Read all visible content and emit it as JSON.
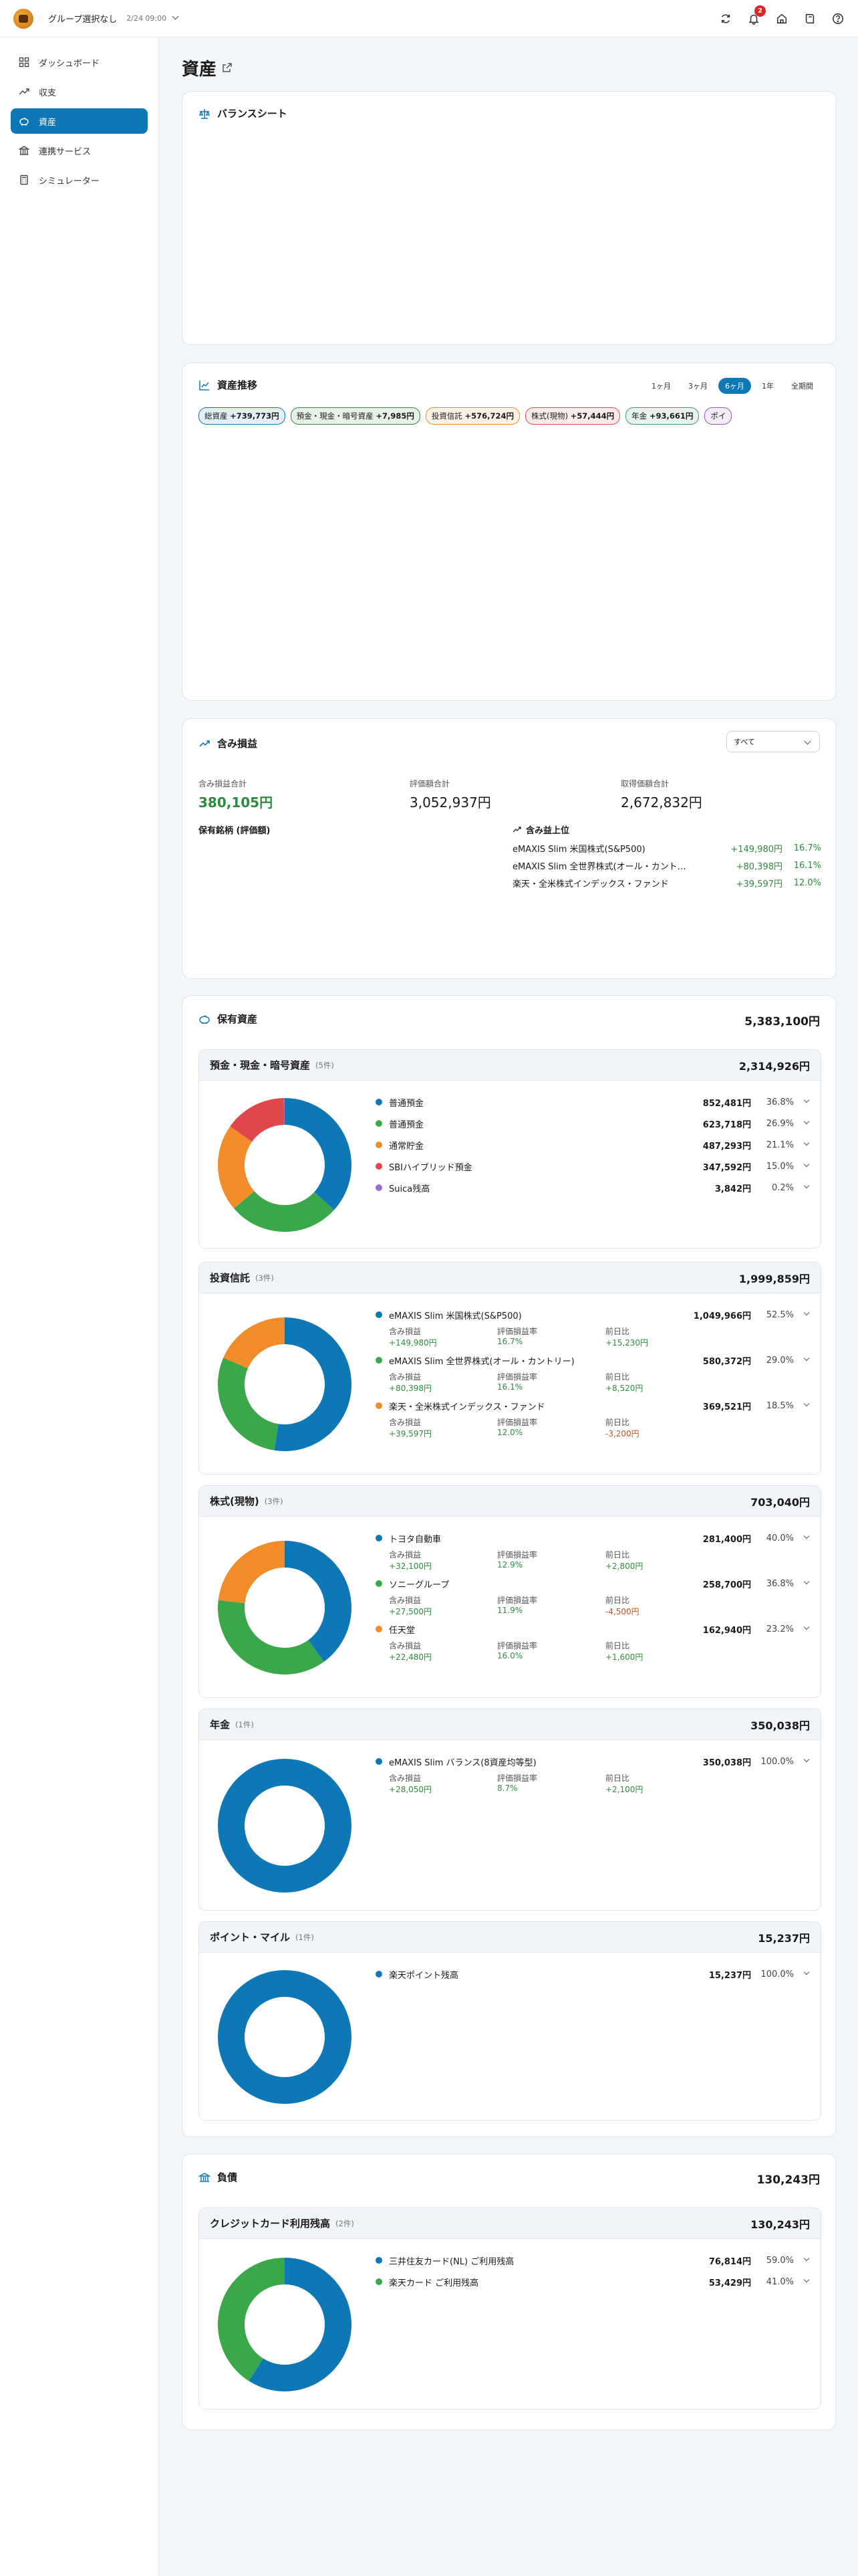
{
  "header": {
    "group": "グループ選択なし",
    "date": "2/24 09:00",
    "notif_count": "2"
  },
  "nav": [
    "ダッシュボード",
    "収支",
    "資産",
    "連携サービス",
    "シミュレーター"
  ],
  "page_title": "資産",
  "balance": {
    "title": "バランスシート"
  },
  "trend": {
    "title": "資産推移",
    "ranges": [
      "1ヶ月",
      "3ヶ月",
      "6ヶ月",
      "1年",
      "全期間"
    ],
    "chips": [
      {
        "label": "総資産",
        "value": "+739,773円",
        "color": "#0e78b7"
      },
      {
        "label": "預金・現金・暗号資産",
        "value": "+7,985円",
        "color": "#2e8b3e"
      },
      {
        "label": "投資信託",
        "value": "+576,724円",
        "color": "#f28c28"
      },
      {
        "label": "株式(現物)",
        "value": "+57,444円",
        "color": "#e05252"
      },
      {
        "label": "年金",
        "value": "+93,661円",
        "color": "#3aa06a"
      },
      {
        "label": "ポイ",
        "value": "",
        "color": "#9b59b6"
      }
    ]
  },
  "unrealized": {
    "title": "含み損益",
    "filter": "すべて",
    "stats": [
      {
        "label": "含み損益合計",
        "value": "380,105円"
      },
      {
        "label": "評価額合計",
        "value": "3,052,937円"
      },
      {
        "label": "取得価額合計",
        "value": "2,672,832円"
      }
    ],
    "by_holding": "保有銘柄 (評価額)",
    "top_title": "含み益上位",
    "top": [
      {
        "name": "eMAXIS Slim 米国株式(S&P500)",
        "amount": "+149,980円",
        "pct": "16.7%"
      },
      {
        "name": "eMAXIS Slim 全世界株式(オール・カント…",
        "amount": "+80,398円",
        "pct": "16.1%"
      },
      {
        "name": "楽天・全米株式インデックス・ファンド",
        "amount": "+39,597円",
        "pct": "12.0%"
      }
    ]
  },
  "labels": {
    "gain": "含み損益",
    "rate": "評価損益率",
    "day": "前日比"
  },
  "holdings": {
    "title": "保有資産",
    "total": "5,383,100円",
    "groups": [
      {
        "name": "預金・現金・暗号資産",
        "count": "(5件)",
        "amount": "2,314,926円",
        "items": [
          {
            "name": "普通預金",
            "amount": "852,481円",
            "pct": "36.8%",
            "share": 36.8,
            "color": "#0e78b7"
          },
          {
            "name": "普通預金",
            "amount": "623,718円",
            "pct": "26.9%",
            "share": 26.9,
            "color": "#3aa84a"
          },
          {
            "name": "通常貯金",
            "amount": "487,293円",
            "pct": "21.1%",
            "share": 21.1,
            "color": "#f28c28"
          },
          {
            "name": "SBIハイブリッド預金",
            "amount": "347,592円",
            "pct": "15.0%",
            "share": 15.0,
            "color": "#e0474c"
          },
          {
            "name": "Suica残高",
            "amount": "3,842円",
            "pct": "0.2%",
            "share": 0.2,
            "color": "#9b6bd0"
          }
        ]
      },
      {
        "name": "投資信託",
        "count": "(3件)",
        "amount": "1,999,859円",
        "items": [
          {
            "name": "eMAXIS Slim 米国株式(S&P500)",
            "amount": "1,049,966円",
            "pct": "52.5%",
            "share": 52.5,
            "color": "#0e78b7",
            "gain": "+149,980円",
            "rate": "16.7%",
            "day": "+15,230円"
          },
          {
            "name": "eMAXIS Slim 全世界株式(オール・カントリー)",
            "amount": "580,372円",
            "pct": "29.0%",
            "share": 29.0,
            "color": "#3aa84a",
            "gain": "+80,398円",
            "rate": "16.1%",
            "day": "+8,520円"
          },
          {
            "name": "楽天・全米株式インデックス・ファンド",
            "amount": "369,521円",
            "pct": "18.5%",
            "share": 18.5,
            "color": "#f28c28",
            "gain": "+39,597円",
            "rate": "12.0%",
            "day": "-3,200円"
          }
        ]
      },
      {
        "name": "株式(現物)",
        "count": "(3件)",
        "amount": "703,040円",
        "items": [
          {
            "name": "トヨタ自動車",
            "amount": "281,400円",
            "pct": "40.0%",
            "share": 40.0,
            "color": "#0e78b7",
            "gain": "+32,100円",
            "rate": "12.9%",
            "day": "+2,800円"
          },
          {
            "name": "ソニーグループ",
            "amount": "258,700円",
            "pct": "36.8%",
            "share": 36.8,
            "color": "#3aa84a",
            "gain": "+27,500円",
            "rate": "11.9%",
            "day": "-4,500円"
          },
          {
            "name": "任天堂",
            "amount": "162,940円",
            "pct": "23.2%",
            "share": 23.2,
            "color": "#f28c28",
            "gain": "+22,480円",
            "rate": "16.0%",
            "day": "+1,600円"
          }
        ]
      },
      {
        "name": "年金",
        "count": "(1件)",
        "amount": "350,038円",
        "items": [
          {
            "name": "eMAXIS Slim バランス(8資産均等型)",
            "amount": "350,038円",
            "pct": "100.0%",
            "share": 100,
            "color": "#0e78b7",
            "gain": "+28,050円",
            "rate": "8.7%",
            "day": "+2,100円"
          }
        ]
      },
      {
        "name": "ポイント・マイル",
        "count": "(1件)",
        "amount": "15,237円",
        "items": [
          {
            "name": "楽天ポイント残高",
            "amount": "15,237円",
            "pct": "100.0%",
            "share": 100,
            "color": "#0e78b7"
          }
        ]
      }
    ]
  },
  "liabilities": {
    "title": "負債",
    "total": "130,243円",
    "group": {
      "name": "クレジットカード利用残高",
      "count": "(2件)",
      "amount": "130,243円",
      "items": [
        {
          "name": "三井住友カード(NL) ご利用残高",
          "amount": "76,814円",
          "pct": "59.0%",
          "share": 59.0,
          "color": "#0e78b7"
        },
        {
          "name": "楽天カード ご利用残高",
          "amount": "53,429円",
          "pct": "41.0%",
          "share": 41.0,
          "color": "#3aa84a"
        }
      ]
    }
  }
}
